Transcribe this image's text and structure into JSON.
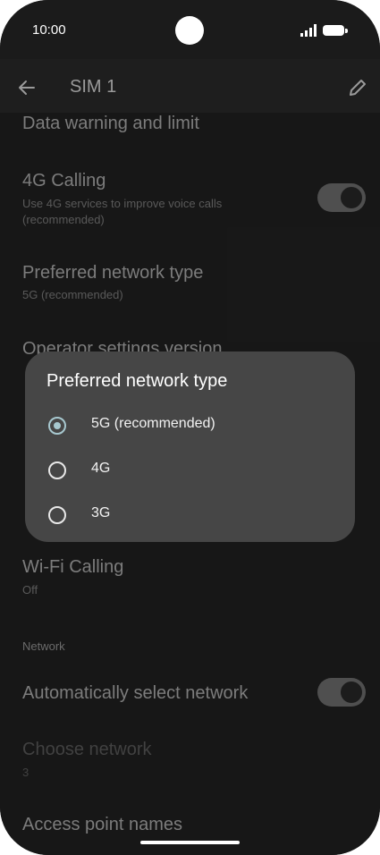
{
  "status_bar": {
    "time": "10:00"
  },
  "app_bar": {
    "title": "SIM 1"
  },
  "settings": {
    "data_warning": {
      "title": "Data warning and limit"
    },
    "calling_4g": {
      "title": "4G Calling",
      "subtitle": "Use 4G services to improve voice calls (recommended)"
    },
    "preferred_network": {
      "title": "Preferred network type",
      "subtitle": "5G (recommended)"
    },
    "operator_settings": {
      "title": "Operator settings version"
    },
    "wifi_calling": {
      "title": "Wi-Fi Calling",
      "subtitle": "Off"
    },
    "network_section": "Network",
    "auto_select": {
      "title": "Automatically select network"
    },
    "choose_network": {
      "title": "Choose network",
      "subtitle": "3"
    },
    "apn": {
      "title": "Access point names"
    }
  },
  "dialog": {
    "title": "Preferred network type",
    "options": [
      {
        "label": "5G (recommended)",
        "selected": true
      },
      {
        "label": "4G",
        "selected": false
      },
      {
        "label": "3G",
        "selected": false
      }
    ]
  }
}
